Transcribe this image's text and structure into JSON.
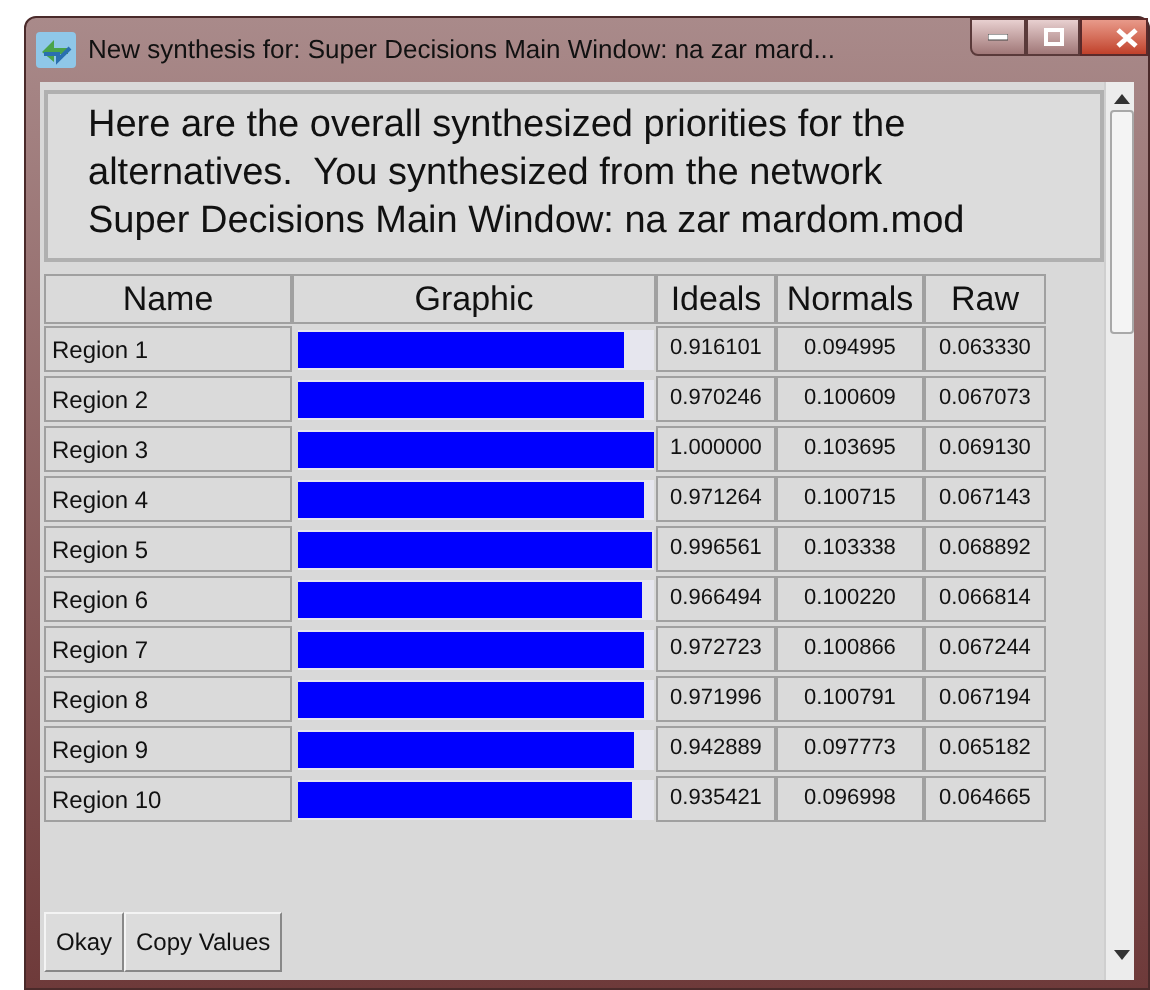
{
  "window": {
    "title": "New synthesis for: Super Decisions Main Window: na zar mard..."
  },
  "message": "Here are the overall synthesized priorities for the alternatives.  You synthesized from the network Super Decisions Main Window: na zar mardom.mod",
  "table": {
    "columns": [
      "Name",
      "Graphic",
      "Ideals",
      "Normals",
      "Raw"
    ],
    "rows": [
      {
        "name": "Region 1",
        "level": 0.916101,
        "ideals": "0.916101",
        "normals": "0.094995",
        "raw": "0.063330"
      },
      {
        "name": "Region 2",
        "level": 0.970246,
        "ideals": "0.970246",
        "normals": "0.100609",
        "raw": "0.067073"
      },
      {
        "name": "Region 3",
        "level": 1.0,
        "ideals": "1.000000",
        "normals": "0.103695",
        "raw": "0.069130"
      },
      {
        "name": "Region 4",
        "level": 0.971264,
        "ideals": "0.971264",
        "normals": "0.100715",
        "raw": "0.067143"
      },
      {
        "name": "Region 5",
        "level": 0.996561,
        "ideals": "0.996561",
        "normals": "0.103338",
        "raw": "0.068892"
      },
      {
        "name": "Region 6",
        "level": 0.966494,
        "ideals": "0.966494",
        "normals": "0.100220",
        "raw": "0.066814"
      },
      {
        "name": "Region 7",
        "level": 0.972723,
        "ideals": "0.972723",
        "normals": "0.100866",
        "raw": "0.067244"
      },
      {
        "name": "Region 8",
        "level": 0.971996,
        "ideals": "0.971996",
        "normals": "0.100791",
        "raw": "0.067194"
      },
      {
        "name": "Region 9",
        "level": 0.942889,
        "ideals": "0.942889",
        "normals": "0.097773",
        "raw": "0.065182"
      },
      {
        "name": "Region 10",
        "level": 0.935421,
        "ideals": "0.935421",
        "normals": "0.096998",
        "raw": "0.064665"
      }
    ]
  },
  "buttons": [
    "Okay",
    "Copy Values"
  ]
}
